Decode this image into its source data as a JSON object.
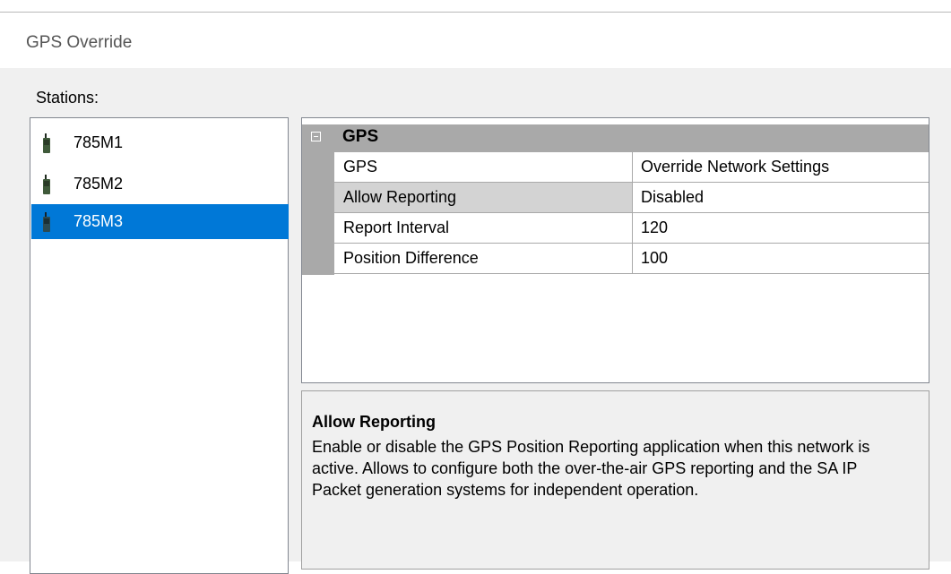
{
  "dialog": {
    "title": "GPS Override"
  },
  "stations": {
    "label": "Stations:",
    "items": [
      {
        "label": "785M1",
        "icon": "radio-icon",
        "selected": false
      },
      {
        "label": "785M2",
        "icon": "radio-icon",
        "selected": false
      },
      {
        "label": "785M3",
        "icon": "radio-icon",
        "selected": true
      }
    ]
  },
  "property_grid": {
    "category": "GPS",
    "rows": [
      {
        "name": "GPS",
        "value": "Override Network Settings"
      },
      {
        "name": "Allow Reporting",
        "value": "Disabled",
        "selected": true
      },
      {
        "name": "Report Interval",
        "value": "120"
      },
      {
        "name": "Position Difference",
        "value": "100"
      }
    ]
  },
  "description": {
    "title": "Allow Reporting",
    "text": "Enable or disable the GPS Position Reporting application when this network is active.  Allows to configure both the over-the-air GPS reporting and the SA IP Packet generation systems for independent operation."
  },
  "colors": {
    "selection": "#0078d7",
    "category_band": "#a9a9a9",
    "window_bg": "#f0f0f0"
  }
}
